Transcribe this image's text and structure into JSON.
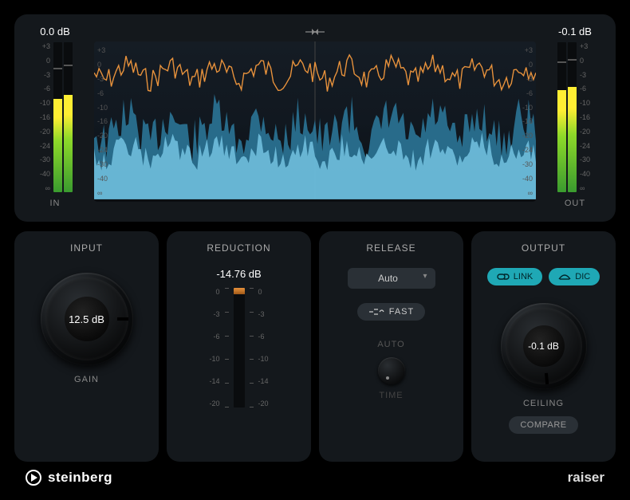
{
  "meters": {
    "in": {
      "value": "0.0 dB",
      "label": "IN",
      "fill_pct": [
        62,
        65
      ],
      "peak_pct": [
        82,
        84
      ]
    },
    "out": {
      "value": "-0.1 dB",
      "label": "OUT",
      "fill_pct": [
        68,
        70
      ],
      "peak_pct": [
        86,
        88
      ]
    },
    "scale": [
      "+3",
      "0",
      "-3",
      "-6",
      "-10",
      "-16",
      "-20",
      "-24",
      "-30",
      "-40",
      "∞"
    ]
  },
  "input": {
    "title": "INPUT",
    "value": "12.5 dB",
    "label": "GAIN",
    "rotation": 90
  },
  "reduction": {
    "title": "REDUCTION",
    "value": "-14.76 dB",
    "scale": [
      "0",
      "-3",
      "-6",
      "-10",
      "-14",
      "-20"
    ]
  },
  "release": {
    "title": "RELEASE",
    "mode": "Auto",
    "fast_label": "FAST",
    "auto_label": "AUTO",
    "time_label": "TIME"
  },
  "output": {
    "title": "OUTPUT",
    "link_label": "LINK",
    "dic_label": "DIC",
    "value": "-0.1 dB",
    "ceiling_label": "CEILING",
    "compare_label": "COMPARE",
    "rotation": 175
  },
  "footer": {
    "brand": "steinberg",
    "product": "raiser"
  }
}
